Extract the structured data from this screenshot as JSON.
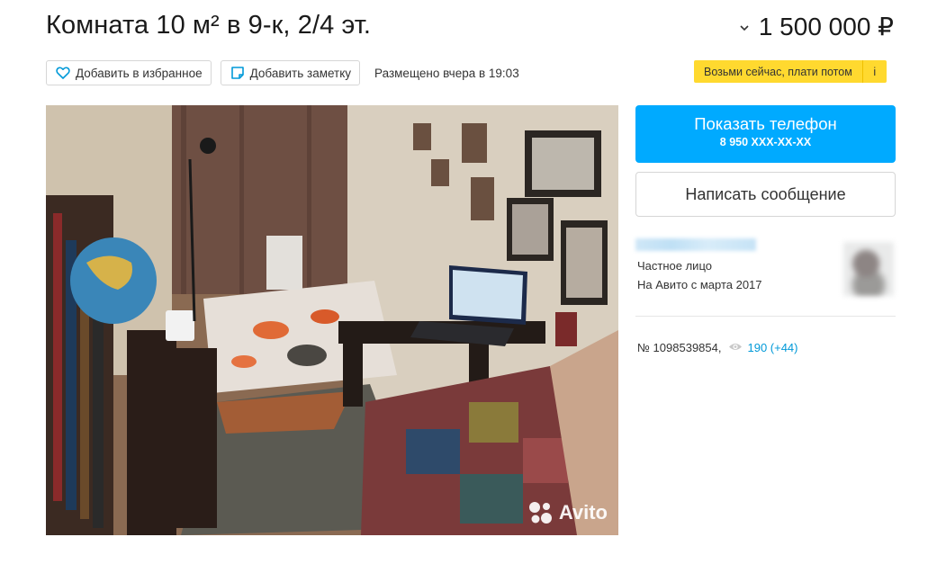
{
  "listing": {
    "title": "Комната 10 м² в 9-к, 2/4 эт.",
    "price": "1 500 000 ₽",
    "posted": "Размещено вчера в 19:03",
    "number": "№ 1098539854,",
    "views": "190 (+44)"
  },
  "actions": {
    "favorite_label": "Добавить в избранное",
    "note_label": "Добавить заметку"
  },
  "promo": {
    "label": "Возьми сейчас, плати потом",
    "info": "i"
  },
  "photo": {
    "watermark": "Avito"
  },
  "contact": {
    "phone_button_label": "Показать телефон",
    "phone_masked": "8 950 XXX-XX-XX",
    "message_button_label": "Написать сообщение"
  },
  "seller": {
    "type": "Частное лицо",
    "since": "На Авито с марта 2017"
  },
  "icons": {
    "favorite": "heart-outline-icon",
    "note": "note-icon",
    "views": "eye-icon",
    "price_menu": "chevron-down-icon"
  },
  "colors": {
    "accent_blue": "#00aaff",
    "promo_yellow": "#ffd92f",
    "views_link": "#0099d8"
  }
}
